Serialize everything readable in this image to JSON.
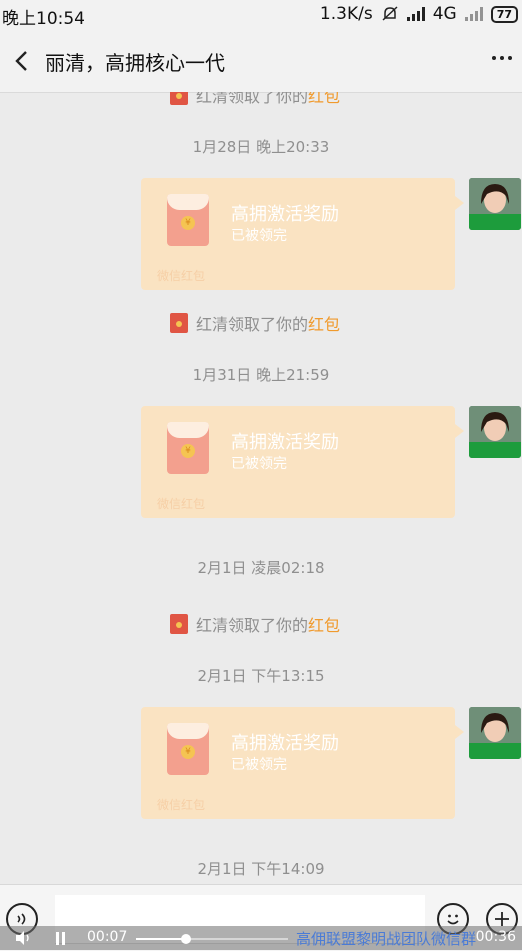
{
  "status_bar": {
    "time": "晚上10:54",
    "speed": "1.3K/s",
    "network": "4G",
    "battery": "77"
  },
  "header": {
    "title": "丽清，高拥核心一代"
  },
  "messages": [
    {
      "type": "system_redpacket",
      "prefix": "红清领取了你的",
      "link": "红包"
    },
    {
      "type": "timestamp",
      "text": "1月28日 晚上20:33"
    },
    {
      "type": "redpacket",
      "title": "高拥激活奖励",
      "status": "已被领完",
      "footer": "微信红包"
    },
    {
      "type": "system_redpacket",
      "prefix": "红清领取了你的",
      "link": "红包"
    },
    {
      "type": "timestamp",
      "text": "1月31日 晚上21:59"
    },
    {
      "type": "redpacket",
      "title": "高拥激活奖励",
      "status": "已被领完",
      "footer": "微信红包"
    },
    {
      "type": "timestamp",
      "text": "2月1日 凌晨02:18"
    },
    {
      "type": "system_redpacket",
      "prefix": "红清领取了你的",
      "link": "红包"
    },
    {
      "type": "timestamp",
      "text": "2月1日 下午13:15"
    },
    {
      "type": "redpacket",
      "title": "高拥激活奖励",
      "status": "已被领完",
      "footer": "微信红包"
    },
    {
      "type": "timestamp",
      "text": "2月1日 下午14:09"
    }
  ],
  "video_player": {
    "current_time": "00:07",
    "duration": "00:36",
    "progress": 0.33,
    "watermark": "高佣联盟黎明战团队微信群"
  },
  "colors": {
    "background": "#ebebeb",
    "bubble": "#fae3c2",
    "highlight": "#f09a2d",
    "packet_red": "#e05544"
  }
}
